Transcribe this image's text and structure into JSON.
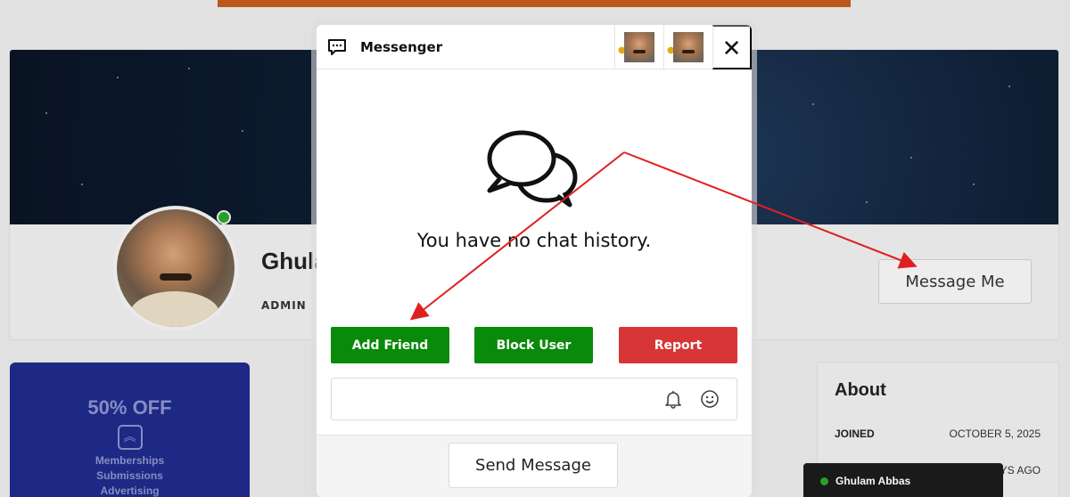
{
  "profile": {
    "name": "Ghula",
    "role": "ADMIN",
    "message_button": "Message Me"
  },
  "promo": {
    "title": "50% OFF",
    "lines": [
      "Memberships",
      "Submissions",
      "Advertising"
    ]
  },
  "about": {
    "title": "About",
    "joined_label": "JOINED",
    "joined_value": "OCTOBER 5, 2025",
    "second_value_fragment": "YS AGO"
  },
  "chat_bar": {
    "name": "Ghulam Abbas",
    "status_color": "#2aa52a"
  },
  "messenger": {
    "title": "Messenger",
    "empty_text": "You have no chat history.",
    "buttons": {
      "add_friend": "Add Friend",
      "block_user": "Block User",
      "report": "Report"
    },
    "input_placeholder": "",
    "send_label": "Send Message",
    "close_glyph": "✕"
  },
  "colors": {
    "green": "#0a8a0a",
    "red": "#d83636",
    "annotation": "#e02020"
  }
}
